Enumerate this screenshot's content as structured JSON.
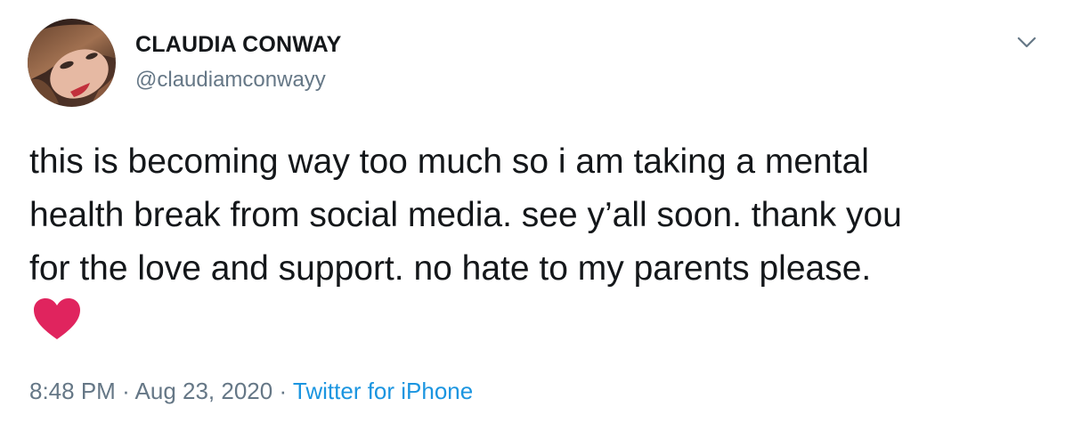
{
  "user": {
    "display_name": "CLAUDIA CONWAY",
    "handle": "@claudiamconwayy"
  },
  "tweet": {
    "lines": [
      "this is becoming way too much so i am taking a mental",
      "health break from social media. see y’all soon. thank you",
      "for the love and support. no hate to my parents please."
    ],
    "emoji": "red-heart",
    "time": "8:48 PM",
    "separator": "·",
    "date": "Aug 23, 2020",
    "source": "Twitter for iPhone"
  },
  "icons": {
    "menu": "chevron-down-icon",
    "heart": "heart-icon"
  },
  "colors": {
    "text": "#14171a",
    "secondary": "#657786",
    "link": "#1b95e0",
    "heart": "#e0245e"
  }
}
